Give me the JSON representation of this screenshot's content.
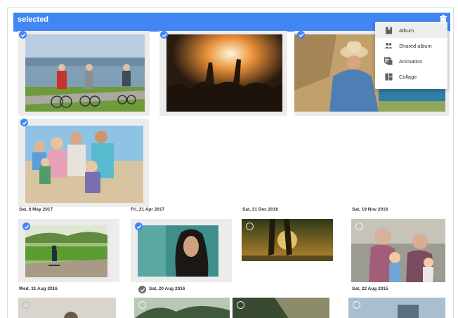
{
  "header": {
    "title": "selected",
    "trash_icon": "trash-icon"
  },
  "menu": {
    "items": [
      {
        "label": "Album",
        "icon": "album-icon"
      },
      {
        "label": "Shared album",
        "icon": "shared-album-icon"
      },
      {
        "label": "Animation",
        "icon": "animation-icon"
      },
      {
        "label": "Collage",
        "icon": "collage-icon"
      }
    ]
  },
  "selected_group": {
    "photos": [
      "cyclists-photo",
      "concert-photo",
      "woman-hat-photo",
      "family-photo"
    ]
  },
  "dates": [
    "Sat, 6 May 2017",
    "Fri, 21 Apr 2017",
    "Sat, 31 Dec 2016",
    "Sat, 19 Nov 2016",
    "Wed, 31 Aug 2016",
    "Sat, 20 Aug 2016",
    "Sat, 22 Aug 2015"
  ],
  "colors": {
    "accent": "#4285f4",
    "tile_bg": "#ececec"
  }
}
